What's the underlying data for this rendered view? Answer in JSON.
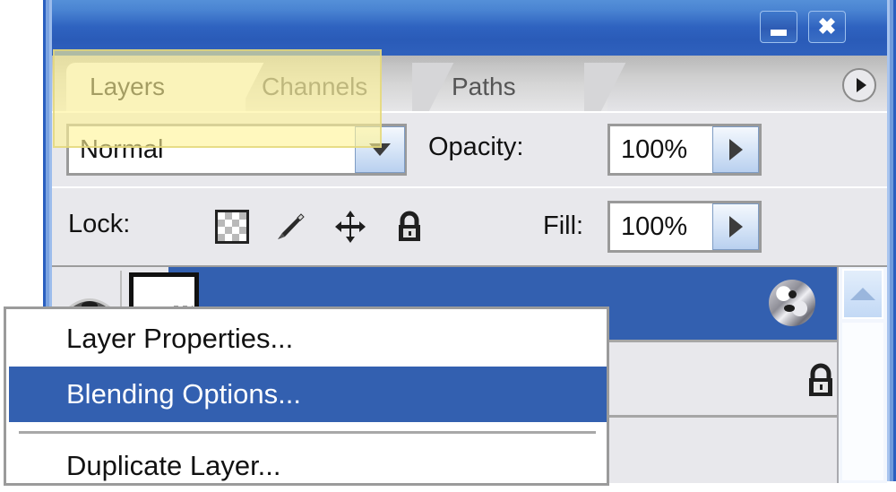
{
  "window": {
    "minimize_label": "Minimize",
    "close_label": "Close",
    "minimize_glyph": "minimize-icon",
    "close_glyph": "close-icon"
  },
  "tabs": [
    {
      "label": "Layers",
      "active": true
    },
    {
      "label": "Channels",
      "active": false
    },
    {
      "label": "Paths",
      "active": false
    }
  ],
  "panel_menu": {
    "icon": "panel-menu-icon",
    "tooltip": "Palette menu"
  },
  "blend": {
    "mode_value": "Normal",
    "dropdown_icon": "chevron-down-icon",
    "opacity_label": "Opacity:",
    "opacity_value": "100%",
    "opacity_stepper_icon": "triangle-right-icon"
  },
  "lock": {
    "label": "Lock:",
    "icons": [
      {
        "name": "lock-transparency-icon",
        "title": "Lock transparent pixels"
      },
      {
        "name": "lock-image-brush-icon",
        "title": "Lock image pixels"
      },
      {
        "name": "lock-position-move-icon",
        "title": "Lock position"
      },
      {
        "name": "lock-all-padlock-icon",
        "title": "Lock all"
      }
    ],
    "fill_label": "Fill:",
    "fill_value": "100%",
    "fill_stepper_icon": "triangle-right-icon"
  },
  "layers": [
    {
      "selected": true,
      "visibility_icon": "eye-icon",
      "thumbnail_icon": "layer-thumbnail",
      "effects_icon": "layer-style-fx-icon",
      "expand_icon": "chevron-down-icon"
    },
    {
      "selected": false,
      "lock_icon": "padlock-icon"
    }
  ],
  "scrollbar": {
    "up_arrow_icon": "scroll-up-icon"
  },
  "context_menu": {
    "items": [
      {
        "label": "Layer Properties...",
        "highlighted": false
      },
      {
        "label": "Blending Options...",
        "highlighted": true
      },
      {
        "label": "Duplicate Layer...",
        "highlighted": false
      }
    ],
    "highlight_overlay": "blending-options-highlight"
  },
  "colors": {
    "titlebar_blue": "#2f63c0",
    "selection_blue": "#3360b0",
    "panel_gray": "#e8e8ec",
    "highlight_yellow": "#fff396",
    "tab_active": "#f2f2f4"
  }
}
